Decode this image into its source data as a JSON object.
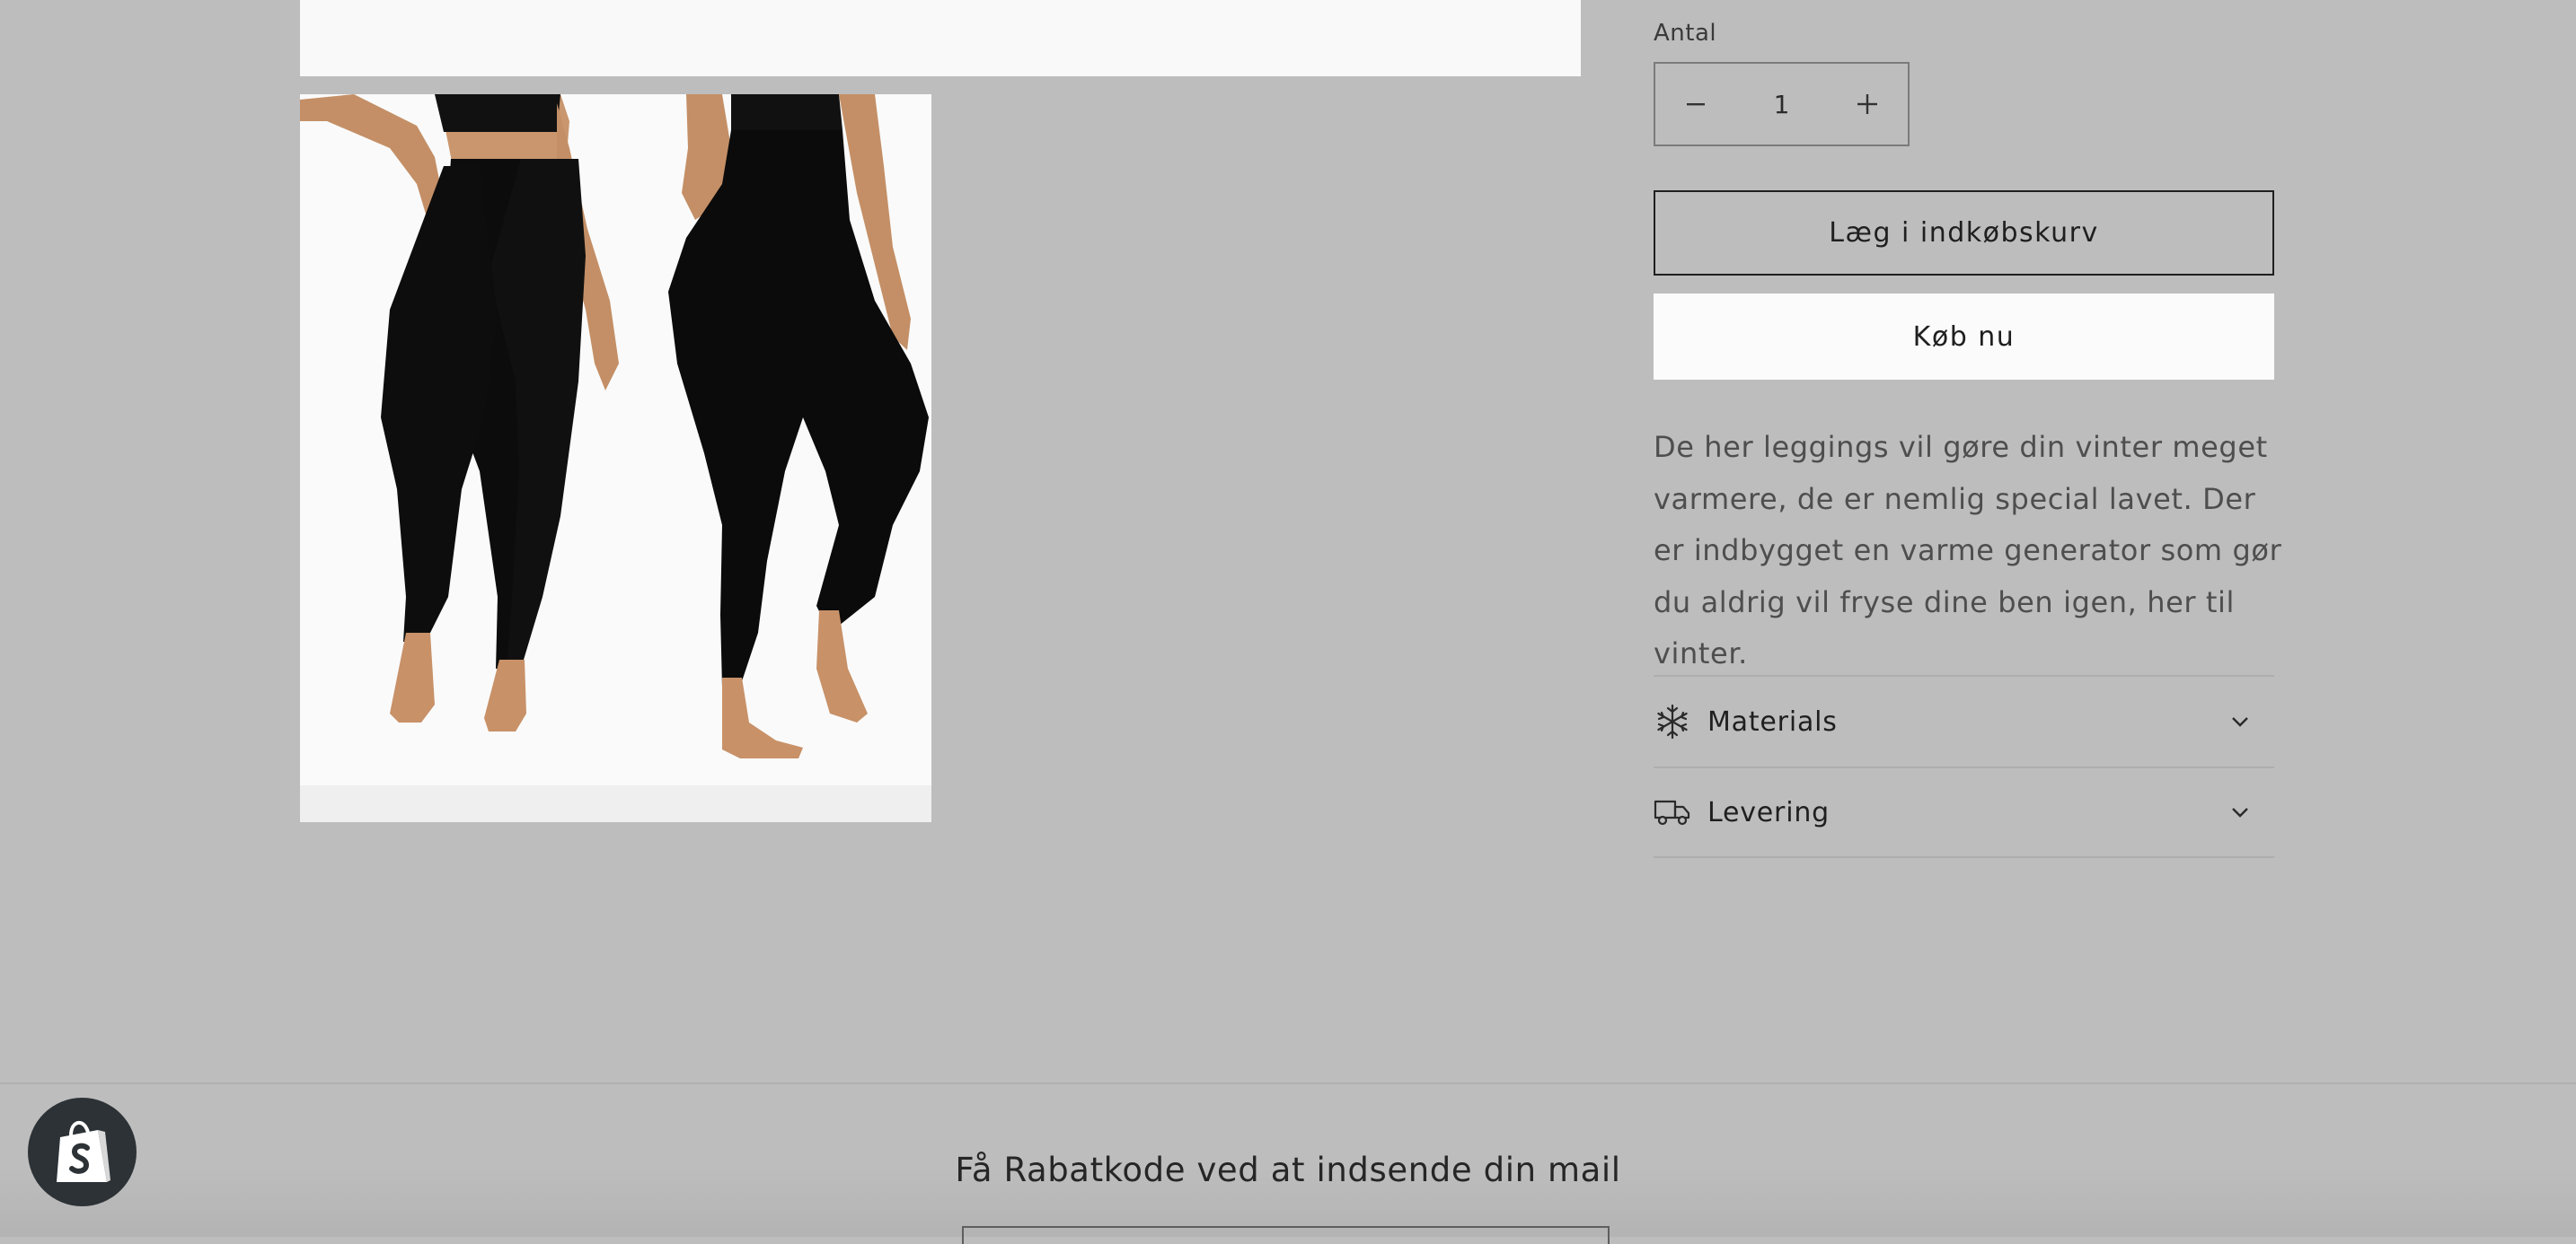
{
  "product": {
    "quantity_label": "Antal",
    "quantity_value": "1",
    "add_to_cart_label": "Læg i indkøbskurv",
    "buy_now_label": "Køb nu",
    "description": "De her leggings vil gøre din vinter meget varmere, de er nemlig special lavet. Der er indbygget en varme generator som gør du aldrig vil fryse dine ben igen, her til vinter.",
    "accordion": [
      {
        "label": "Materials",
        "icon": "snowflake-icon"
      },
      {
        "label": "Levering",
        "icon": "truck-icon"
      }
    ]
  },
  "footer": {
    "newsletter_heading": "Få Rabatkode ved at indsende din mail"
  },
  "colors": {
    "page_background": "#bdbdbd",
    "button_white": "#fbfbfb",
    "badge_dark": "#2c3236"
  }
}
